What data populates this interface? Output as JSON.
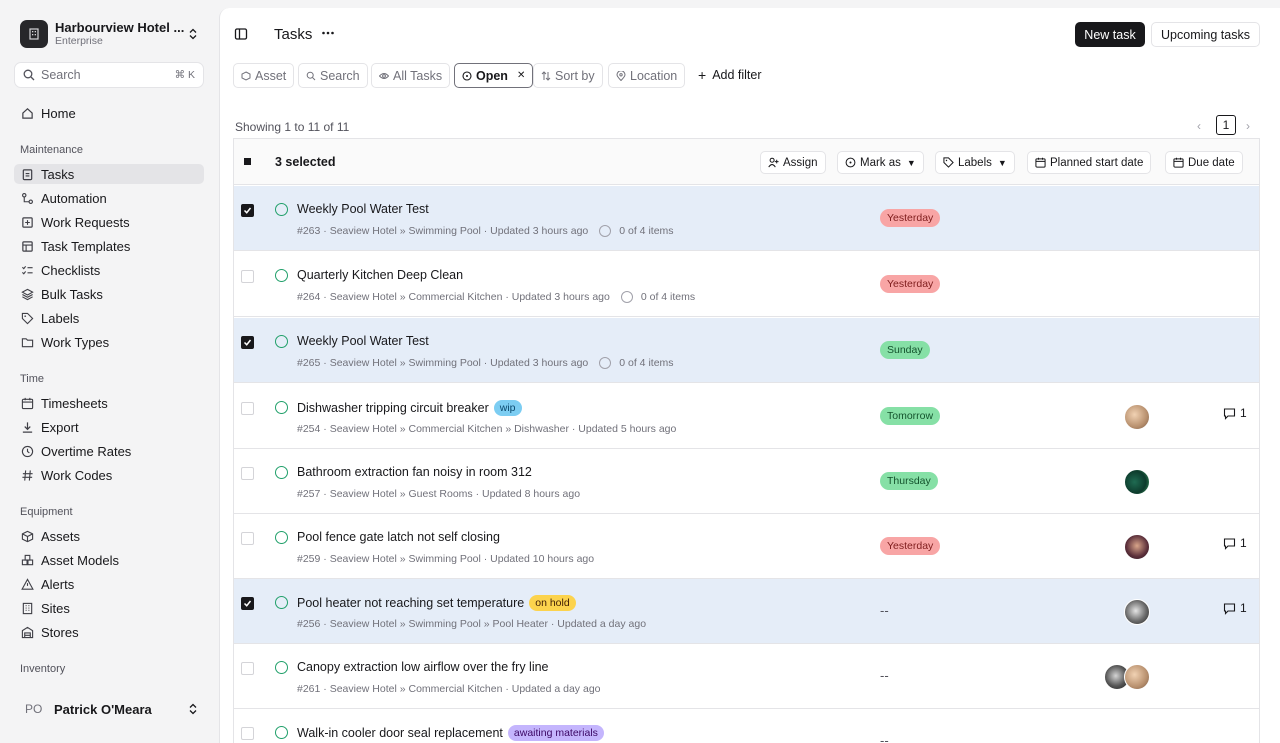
{
  "sidebar": {
    "org_name": "Harbourview Hotel ...",
    "org_plan": "Enterprise",
    "search_placeholder": "Search",
    "search_kbd": "⌘  K",
    "home": "Home",
    "sections": {
      "maintenance": "Maintenance",
      "time": "Time",
      "equipment": "Equipment",
      "inventory": "Inventory"
    },
    "maintenance_items": [
      "Tasks",
      "Automation",
      "Work Requests",
      "Task Templates",
      "Checklists",
      "Bulk Tasks",
      "Labels",
      "Work Types"
    ],
    "time_items": [
      "Timesheets",
      "Export",
      "Overtime Rates",
      "Work Codes"
    ],
    "equipment_items": [
      "Assets",
      "Asset Models",
      "Alerts",
      "Sites",
      "Stores"
    ],
    "user_initials": "PO",
    "user_name": "Patrick O'Meara"
  },
  "header": {
    "title": "Tasks",
    "dots": "•••",
    "new_task": "New task",
    "upcoming": "Upcoming tasks"
  },
  "filters": {
    "asset": "Asset",
    "search": "Search",
    "all_tasks": "All Tasks",
    "open": "Open",
    "sort_by": "Sort by",
    "location": "Location",
    "add_filter": "Add filter"
  },
  "pager": {
    "showing": "Showing 1 to 11 of 11",
    "page": "1"
  },
  "bulk": {
    "selected": "3 selected",
    "assign": "Assign",
    "mark_as": "Mark as",
    "labels": "Labels",
    "planned_start": "Planned start date",
    "due_date": "Due date"
  },
  "tasks": [
    {
      "title": "Weekly Pool Water Test",
      "meta": "#263 · Seaview Hotel » Swimming Pool · Updated 3 hours ago",
      "items": "0 of 4 items",
      "due": "Yesterday",
      "due_style": "red",
      "selected": true
    },
    {
      "title": "Quarterly Kitchen Deep Clean",
      "meta": "#264 · Seaview Hotel » Commercial Kitchen · Updated 3 hours ago",
      "items": "0 of 4 items",
      "due": "Yesterday",
      "due_style": "red",
      "selected": false
    },
    {
      "title": "Weekly Pool Water Test",
      "meta": "#265 · Seaview Hotel » Swimming Pool · Updated 3 hours ago",
      "items": "0 of 4 items",
      "due": "Sunday",
      "due_style": "green",
      "selected": true
    },
    {
      "title": "Dishwasher tripping circuit breaker",
      "badge": "wip",
      "meta": "#254 · Seaview Hotel » Commercial Kitchen » Dishwasher · Updated 5 hours ago",
      "due": "Tomorrow",
      "due_style": "green",
      "comments": "1",
      "selected": false
    },
    {
      "title": "Bathroom extraction fan noisy in room 312",
      "meta": "#257 · Seaview Hotel » Guest Rooms · Updated 8 hours ago",
      "due": "Thursday",
      "due_style": "green",
      "selected": false
    },
    {
      "title": "Pool fence gate latch not self closing",
      "meta": "#259 · Seaview Hotel » Swimming Pool · Updated 10 hours ago",
      "due": "Yesterday",
      "due_style": "red",
      "comments": "1",
      "selected": false
    },
    {
      "title": "Pool heater not reaching set temperature",
      "badge": "on hold",
      "meta": "#256 · Seaview Hotel » Swimming Pool » Pool Heater · Updated a day ago",
      "due": "--",
      "due_style": "none",
      "comments": "1",
      "selected": true
    },
    {
      "title": "Canopy extraction low airflow over the fry line",
      "meta": "#261 · Seaview Hotel » Commercial Kitchen · Updated a day ago",
      "due": "--",
      "due_style": "none",
      "selected": false
    },
    {
      "title": "Walk-in cooler door seal replacement",
      "badge": "awaiting materials",
      "meta": "",
      "due": "--",
      "due_style": "none",
      "selected": false
    }
  ]
}
